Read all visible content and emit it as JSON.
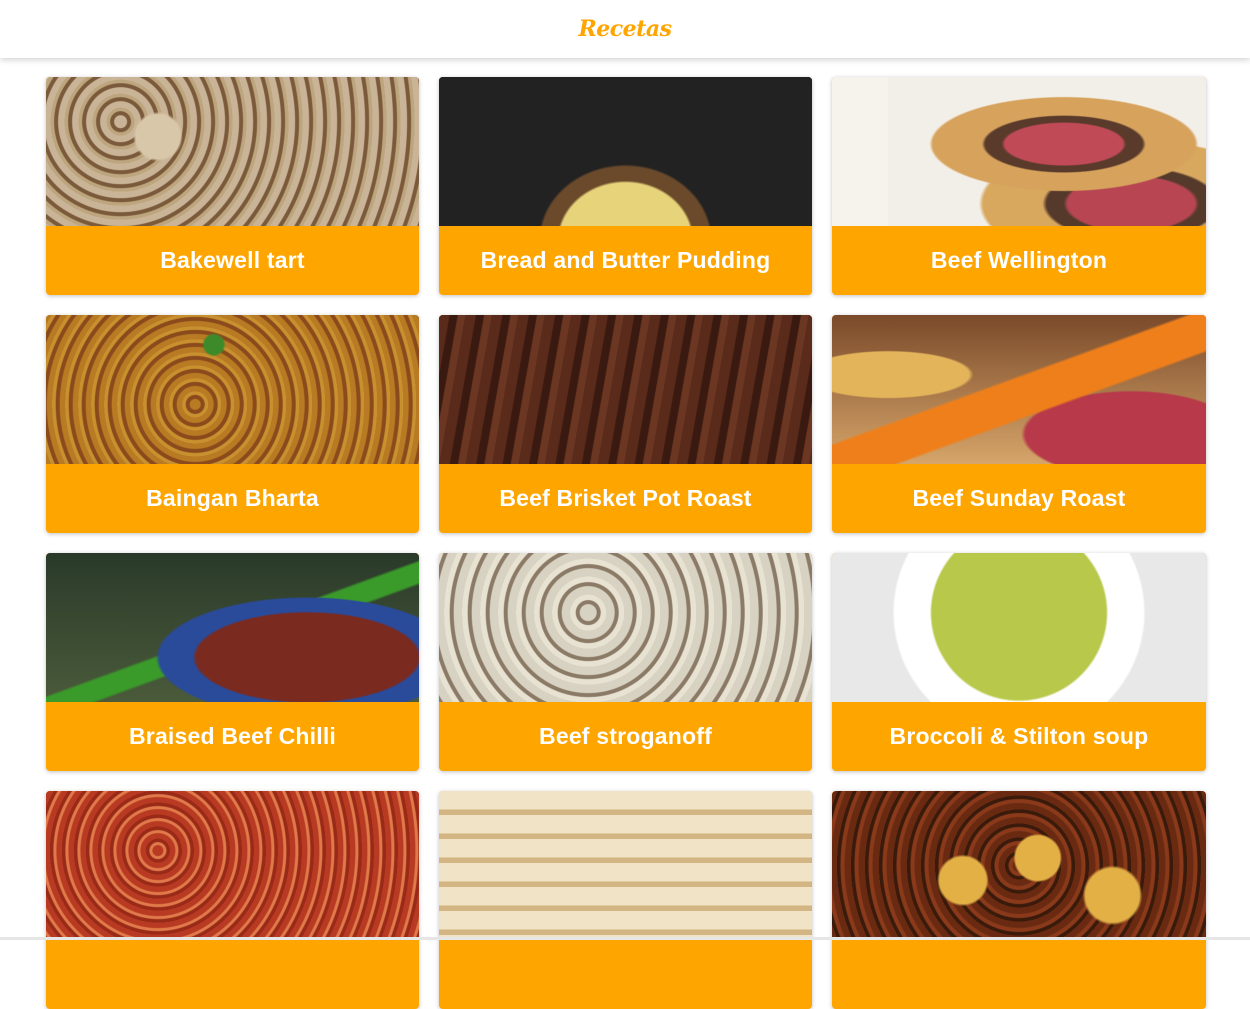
{
  "header": {
    "brand": "Recetas"
  },
  "colors": {
    "accent": "#FFA500",
    "background": "#ffffff"
  },
  "recipes": [
    {
      "title": "Bakewell tart"
    },
    {
      "title": "Bread and Butter Pudding"
    },
    {
      "title": "Beef Wellington"
    },
    {
      "title": "Baingan Bharta"
    },
    {
      "title": "Beef Brisket Pot Roast"
    },
    {
      "title": "Beef Sunday Roast"
    },
    {
      "title": "Braised Beef Chilli"
    },
    {
      "title": "Beef stroganoff"
    },
    {
      "title": "Broccoli & Stilton soup"
    }
  ]
}
